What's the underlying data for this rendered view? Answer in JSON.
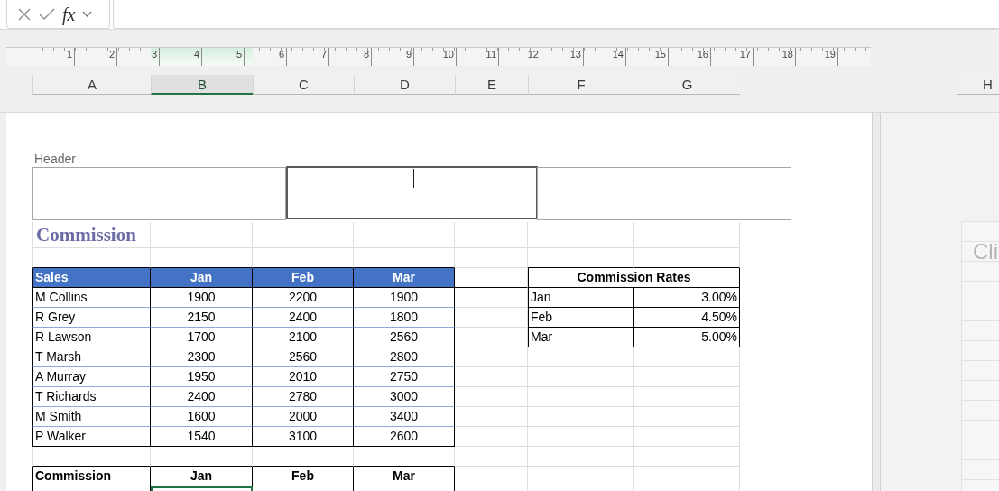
{
  "formula_bar": {
    "function_label": "fx"
  },
  "ruler": {
    "numbers": [
      "1",
      "2",
      "3",
      "4",
      "5",
      "6",
      "7",
      "8",
      "9",
      "10",
      "11",
      "12",
      "13",
      "14",
      "15",
      "16",
      "17",
      "18",
      "19"
    ]
  },
  "columns": [
    {
      "label": "A",
      "selected": false
    },
    {
      "label": "B",
      "selected": true
    },
    {
      "label": "C",
      "selected": false
    },
    {
      "label": "D",
      "selected": false
    },
    {
      "label": "E",
      "selected": false
    },
    {
      "label": "F",
      "selected": false
    },
    {
      "label": "G",
      "selected": false
    }
  ],
  "header": {
    "label": "Header",
    "sections": [
      {
        "selected": false
      },
      {
        "selected": true
      },
      {
        "selected": false
      }
    ]
  },
  "sheet": {
    "title": "Commission",
    "sales_table": {
      "columns": [
        "Sales",
        "Jan",
        "Feb",
        "Mar"
      ],
      "rows": [
        [
          "M Collins",
          "1900",
          "2200",
          "1900"
        ],
        [
          "R Grey",
          "2150",
          "2400",
          "1800"
        ],
        [
          "R Lawson",
          "1700",
          "2100",
          "2560"
        ],
        [
          "T Marsh",
          "2300",
          "2560",
          "2800"
        ],
        [
          "A Murray",
          "1950",
          "2010",
          "2750"
        ],
        [
          "T Richards",
          "2400",
          "2780",
          "3000"
        ],
        [
          "M Smith",
          "1600",
          "2000",
          "3400"
        ],
        [
          "P Walker",
          "1540",
          "3100",
          "2600"
        ]
      ]
    },
    "rates_table": {
      "title": "Commission Rates",
      "rows": [
        [
          "Jan",
          "3.00%"
        ],
        [
          "Feb",
          "4.50%"
        ],
        [
          "Mar",
          "5.00%"
        ]
      ]
    },
    "commission_table": {
      "columns": [
        "Commission",
        "Jan",
        "Feb",
        "Mar"
      ],
      "rows": [
        {
          "cells": [
            {
              "selected": false
            },
            {
              "selected": true
            },
            {
              "selected": false
            },
            {
              "selected": false
            }
          ]
        }
      ]
    }
  },
  "next_page": {
    "column": "H",
    "hint": "Cli"
  }
}
